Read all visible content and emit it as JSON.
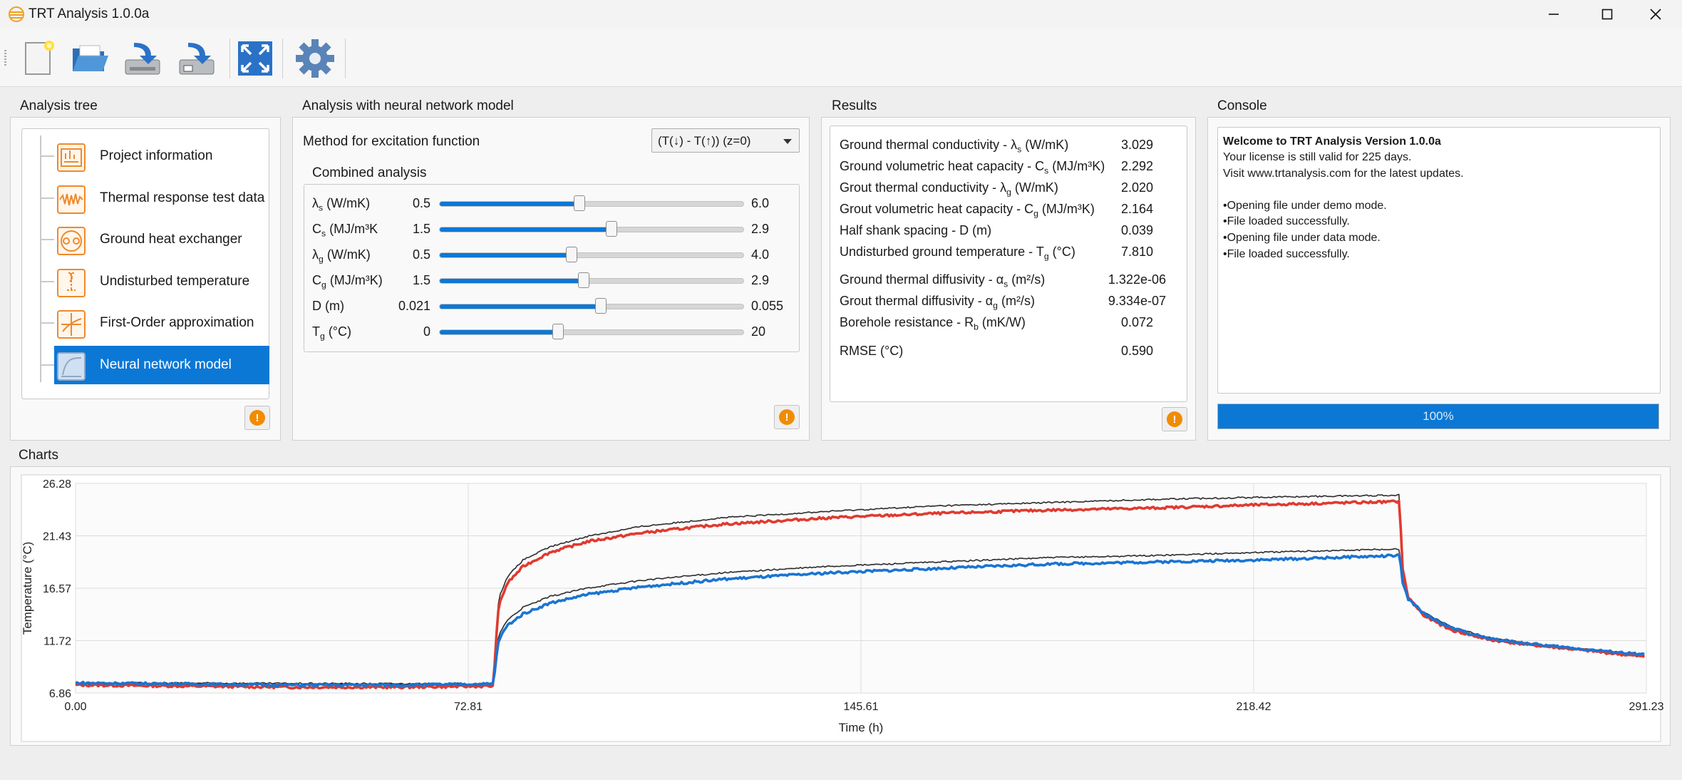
{
  "window": {
    "title": "TRT Analysis 1.0.0a"
  },
  "toolbar": {
    "buttons": [
      {
        "name": "new-project",
        "icon": "new-file-icon"
      },
      {
        "name": "open",
        "icon": "folder-open-icon"
      },
      {
        "name": "import",
        "icon": "import-icon"
      },
      {
        "name": "export",
        "icon": "export-icon"
      },
      {
        "name": "fit-view",
        "icon": "fullscreen-icon"
      },
      {
        "name": "settings",
        "icon": "gear-icon"
      }
    ]
  },
  "analysis_tree": {
    "title": "Analysis tree",
    "items": [
      {
        "label": "Project information",
        "icon": "project-icon"
      },
      {
        "label": "Thermal response test data",
        "icon": "signal-icon"
      },
      {
        "label": "Ground heat exchanger",
        "icon": "pipe-icon"
      },
      {
        "label": "Undisturbed temperature",
        "icon": "thermometer-icon"
      },
      {
        "label": "First-Order approximation",
        "icon": "approx-icon"
      },
      {
        "label": "Neural network model",
        "icon": "curve-icon",
        "selected": true
      }
    ]
  },
  "nn_panel": {
    "title": "Analysis with neural network model",
    "method_label": "Method for excitation function",
    "method_value": "(T(↓) - T(↑)) (z=0)",
    "combined_title": "Combined analysis",
    "sliders": [
      {
        "sym": "λ",
        "sub": "s",
        "unit": " (W/mK)",
        "min": "0.5",
        "max": "6.0",
        "min_v": 0.5,
        "max_v": 6.0,
        "value": 3.029
      },
      {
        "sym": "C",
        "sub": "s",
        "unit": " (MJ/m³K",
        "min": "1.5",
        "max": "2.9",
        "min_v": 1.5,
        "max_v": 2.9,
        "value": 2.292
      },
      {
        "sym": "λ",
        "sub": "g",
        "unit": " (W/mK)",
        "min": "0.5",
        "max": "4.0",
        "min_v": 0.5,
        "max_v": 4.0,
        "value": 2.02
      },
      {
        "sym": "C",
        "sub": "g",
        "unit": " (MJ/m³K)",
        "min": "1.5",
        "max": "2.9",
        "min_v": 1.5,
        "max_v": 2.9,
        "value": 2.164
      },
      {
        "sym": "D",
        "sub": "",
        "unit": " (m)",
        "min": "0.021",
        "max": "0.055",
        "min_v": 0.021,
        "max_v": 0.055,
        "value": 0.039
      },
      {
        "sym": "T",
        "sub": "g",
        "unit": " (°C)",
        "min": "0",
        "max": "20",
        "min_v": 0,
        "max_v": 20,
        "value": 7.81
      }
    ]
  },
  "results": {
    "title": "Results",
    "rows": [
      {
        "label": "Ground thermal conductivity - λ",
        "sub": "s",
        "sup": "",
        "unit": " (W/mK)",
        "value": "3.029"
      },
      {
        "label": "Ground volumetric heat capacity - C",
        "sub": "s",
        "sup": "",
        "unit": " (MJ/m³K)",
        "value": "2.292"
      },
      {
        "label": "Grout thermal conductivity - λ",
        "sub": "g",
        "sup": "",
        "unit": " (W/mK)",
        "value": "2.020"
      },
      {
        "label": "Grout volumetric heat capacity - C",
        "sub": "g",
        "sup": "",
        "unit": " (MJ/m³K)",
        "value": "2.164"
      },
      {
        "label": "Half shank spacing - D",
        "sub": "",
        "sup": "",
        "unit": " (m)",
        "value": "0.039"
      },
      {
        "label": "Undisturbed ground temperature - T",
        "sub": "g",
        "sup": "",
        "unit": " (°C)",
        "value": "7.810"
      },
      {
        "label": "Ground thermal diffusivity - α",
        "sub": "s",
        "sup": "",
        "unit": " (m²/s)",
        "value": "1.322e-06"
      },
      {
        "label": "Grout thermal diffusivity - α",
        "sub": "g",
        "sup": "",
        "unit": " (m²/s)",
        "value": "9.334e-07"
      },
      {
        "label": "Borehole resistance - R",
        "sub": "b",
        "sup": "",
        "unit": " (mK/W)",
        "value": "0.072"
      },
      {
        "label": "RMSE (°C)",
        "sub": "",
        "sup": "",
        "unit": "",
        "value": "0.590"
      }
    ]
  },
  "console": {
    "title": "Console",
    "heading": "Welcome to TRT Analysis Version 1.0.0a",
    "lines": [
      "Your license is still valid for 225 days.",
      "Visit www.trtanalysis.com for the latest updates.",
      "",
      "•Opening file under demo mode.",
      "•File loaded successfully.",
      "•Opening file under data mode.",
      "•File loaded successfully."
    ],
    "progress_label": "100%",
    "progress": 1.0
  },
  "charts": {
    "title": "Charts"
  },
  "chart_data": {
    "type": "line",
    "title": "",
    "xlabel": "Time (h)",
    "ylabel": "Temperature (°C)",
    "xlim": [
      0.0,
      291.23
    ],
    "ylim": [
      6.86,
      26.28
    ],
    "xticks": [
      "0.00",
      "72.81",
      "145.61",
      "218.42",
      "291.23"
    ],
    "yticks": [
      "6.86",
      "11.72",
      "16.57",
      "21.43",
      "26.28"
    ],
    "grid": true,
    "colors": {
      "inlet": "#e03a30",
      "outlet": "#1a74d2",
      "model": "#2b2b2b"
    },
    "series": [
      {
        "color": "#e03a30",
        "x": [
          0,
          20,
          40,
          60,
          77.5,
          78,
          78.5,
          80,
          83,
          88,
          95,
          105,
          120,
          140,
          160,
          180,
          200,
          220,
          245.5,
          246,
          247,
          250,
          255,
          262,
          270,
          280,
          291
        ],
        "y": [
          7.6,
          7.5,
          7.4,
          7.4,
          7.5,
          12.2,
          15.0,
          17.0,
          18.6,
          19.9,
          20.9,
          21.7,
          22.5,
          23.1,
          23.5,
          23.8,
          24.0,
          24.3,
          24.6,
          18.5,
          15.8,
          14.0,
          12.7,
          11.8,
          11.3,
          10.8,
          10.2
        ]
      },
      {
        "color": "#1a74d2",
        "x": [
          0,
          20,
          40,
          60,
          77.5,
          78,
          78.5,
          80,
          83,
          88,
          95,
          105,
          120,
          140,
          160,
          180,
          200,
          220,
          245.5,
          246,
          247,
          250,
          255,
          262,
          270,
          280,
          291
        ],
        "y": [
          7.8,
          7.7,
          7.6,
          7.6,
          7.7,
          10.2,
          11.8,
          13.1,
          14.2,
          15.2,
          16.0,
          16.7,
          17.4,
          18.0,
          18.4,
          18.8,
          19.0,
          19.2,
          19.6,
          17.2,
          15.6,
          14.2,
          12.9,
          11.9,
          11.4,
          10.9,
          10.4
        ]
      },
      {
        "color": "#2b2b2b",
        "x": [
          0,
          77.5,
          78,
          78.5,
          80,
          83,
          88,
          95,
          105,
          120,
          140,
          160,
          180,
          200,
          220,
          245.5,
          246,
          247,
          250,
          255,
          262,
          270,
          280,
          291
        ],
        "y": [
          7.7,
          7.6,
          12.8,
          15.7,
          17.6,
          19.2,
          20.4,
          21.4,
          22.3,
          23.1,
          23.7,
          24.2,
          24.5,
          24.8,
          25.0,
          25.2,
          18.8,
          15.9,
          14.1,
          12.8,
          11.9,
          11.3,
          10.9,
          10.3
        ]
      },
      {
        "color": "#2b2b2b",
        "x": [
          0,
          77.5,
          78,
          78.5,
          80,
          83,
          88,
          95,
          105,
          120,
          140,
          160,
          180,
          200,
          220,
          245.5,
          246,
          247,
          250,
          255,
          262,
          270,
          280,
          291
        ],
        "y": [
          7.8,
          7.7,
          10.6,
          12.3,
          13.6,
          14.8,
          15.8,
          16.6,
          17.3,
          18.0,
          18.6,
          19.0,
          19.4,
          19.6,
          19.9,
          20.2,
          17.5,
          15.7,
          14.3,
          13.0,
          12.0,
          11.4,
          10.9,
          10.4
        ]
      }
    ]
  }
}
